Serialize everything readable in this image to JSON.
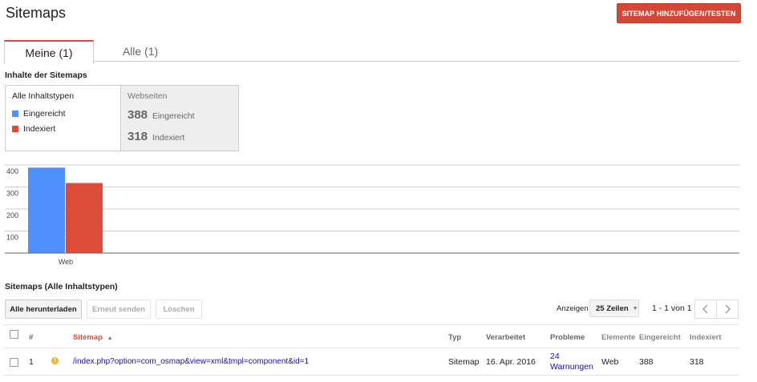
{
  "header": {
    "title": "Sitemaps",
    "add_button": "SITEMAP HINZUFÜGEN/TESTEN"
  },
  "tabs": [
    {
      "label": "Meine (1)",
      "active": true
    },
    {
      "label": "Alle (1)",
      "active": false
    }
  ],
  "contents": {
    "heading": "Inhalte der Sitemaps",
    "legend": {
      "title": "Alle Inhaltstypen",
      "items": [
        {
          "label": "Eingereicht",
          "color": "#4d90fe"
        },
        {
          "label": "Indexiert",
          "color": "#dd4b39"
        }
      ]
    },
    "stats": {
      "title": "Webseiten",
      "rows": [
        {
          "value": "388",
          "label": "Eingereicht"
        },
        {
          "value": "318",
          "label": "Indexiert"
        }
      ]
    }
  },
  "chart_data": {
    "type": "bar",
    "categories": [
      "Web"
    ],
    "series": [
      {
        "name": "Eingereicht",
        "values": [
          388
        ],
        "color": "#4d90fe"
      },
      {
        "name": "Indexiert",
        "values": [
          318
        ],
        "color": "#dd4b39"
      }
    ],
    "y_ticks": [
      "100",
      "200",
      "300",
      "400"
    ],
    "ylim": [
      0,
      400
    ],
    "grid": true
  },
  "list": {
    "heading": "Sitemaps (Alle Inhaltstypen)",
    "buttons": {
      "download_all": "Alle herunterladen",
      "resend": "Erneut senden",
      "delete": "Löschen"
    },
    "show_label": "Anzeigen",
    "rows_select": "25 Zeilen",
    "pagination": "1 - 1 von 1",
    "columns": {
      "num": "#",
      "sitemap": "Sitemap",
      "type": "Typ",
      "processed": "Verarbeitet",
      "issues": "Probleme",
      "elements": "Elemente",
      "submitted": "Eingereicht",
      "indexed": "Indexiert"
    },
    "rows": [
      {
        "num": "1",
        "sitemap": "/index.php?option=com_osmap&view=xml&tmpl=component&id=1",
        "type": "Sitemap",
        "processed": "16. Apr. 2016",
        "issues_count": "24",
        "issues_label": "Warnungen",
        "elements": "Web",
        "submitted": "388",
        "indexed": "318"
      }
    ]
  }
}
